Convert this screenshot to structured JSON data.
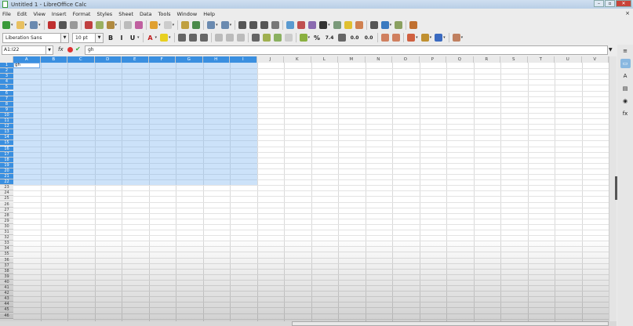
{
  "window": {
    "title": "Untitled 1 - LibreOffice Calc"
  },
  "menu": [
    "File",
    "Edit",
    "View",
    "Insert",
    "Format",
    "Styles",
    "Sheet",
    "Data",
    "Tools",
    "Window",
    "Help"
  ],
  "toolbar1": [
    {
      "n": "new-icon",
      "c": "#3a9a3a",
      "dd": true
    },
    {
      "n": "open-icon",
      "c": "#e8c060",
      "dd": true
    },
    {
      "n": "save-icon",
      "c": "#6a8ab0",
      "dd": true
    },
    {
      "sep": true
    },
    {
      "n": "export-pdf-icon",
      "c": "#c03030"
    },
    {
      "n": "print-icon",
      "c": "#555"
    },
    {
      "n": "print-preview-icon",
      "c": "#999"
    },
    {
      "sep": true
    },
    {
      "n": "cut-icon",
      "c": "#c04040"
    },
    {
      "n": "copy-icon",
      "c": "#9ab060"
    },
    {
      "n": "paste-icon",
      "c": "#b08a40",
      "dd": true
    },
    {
      "sep": true
    },
    {
      "n": "clone-formatting-icon",
      "c": "#bbb"
    },
    {
      "n": "clear-formatting-icon",
      "c": "#c060a0"
    },
    {
      "sep": true
    },
    {
      "n": "undo-icon",
      "c": "#e0a030",
      "dd": true
    },
    {
      "n": "redo-icon",
      "c": "#ccc",
      "dd": true
    },
    {
      "sep": true
    },
    {
      "n": "find-replace-icon",
      "c": "#c0a040"
    },
    {
      "n": "spelling-icon",
      "c": "#4a8a4a"
    },
    {
      "sep": true
    },
    {
      "n": "row-icon",
      "c": "#6a8ab0",
      "dd": true
    },
    {
      "n": "column-icon",
      "c": "#6a8ab0",
      "dd": true
    },
    {
      "sep": true
    },
    {
      "n": "sort-icon",
      "c": "#555"
    },
    {
      "n": "sort-ascending-icon",
      "c": "#555"
    },
    {
      "n": "sort-descending-icon",
      "c": "#555"
    },
    {
      "n": "autofilter-icon",
      "c": "#777"
    },
    {
      "sep": true
    },
    {
      "n": "image-icon",
      "c": "#5a9ad0"
    },
    {
      "n": "chart-icon",
      "c": "#c05050"
    },
    {
      "n": "pivot-table-icon",
      "c": "#8a6ab0"
    },
    {
      "n": "special-character-icon",
      "c": "#333",
      "dd": true
    },
    {
      "n": "hyperlink-icon",
      "c": "#7a9a7a"
    },
    {
      "n": "comment-icon",
      "c": "#e0c030"
    },
    {
      "n": "header-footer-icon",
      "c": "#d08050"
    },
    {
      "sep": true
    },
    {
      "n": "define-print-area-icon",
      "c": "#555"
    },
    {
      "n": "freeze-rows-columns-icon",
      "c": "#3a7ac0",
      "dd": true
    },
    {
      "n": "split-window-icon",
      "c": "#8aa060"
    },
    {
      "sep": true
    },
    {
      "n": "show-draw-functions-icon",
      "c": "#c07030"
    }
  ],
  "toolbar2": {
    "font_name": "Liberation Sans",
    "font_size": "10 pt",
    "icons": [
      {
        "n": "bold-icon",
        "t": "B"
      },
      {
        "n": "italic-icon",
        "t": "I"
      },
      {
        "n": "underline-icon",
        "t": "U",
        "dd": true
      },
      {
        "sep": true
      },
      {
        "n": "font-color-icon",
        "t": "A",
        "col": "#c02020",
        "dd": true
      },
      {
        "n": "highlight-color-icon",
        "c": "#e8d020",
        "dd": true
      },
      {
        "sep": true
      },
      {
        "n": "align-left-icon",
        "c": "#666"
      },
      {
        "n": "align-center-icon",
        "c": "#666"
      },
      {
        "n": "align-right-icon",
        "c": "#666"
      },
      {
        "sep": true
      },
      {
        "n": "align-top-icon",
        "c": "#bbb"
      },
      {
        "n": "align-center-vertical-icon",
        "c": "#bbb"
      },
      {
        "n": "align-bottom-icon",
        "c": "#bbb"
      },
      {
        "sep": true
      },
      {
        "n": "wrap-text-icon",
        "c": "#666"
      },
      {
        "n": "merge-center-icon",
        "c": "#a0b050"
      },
      {
        "n": "merge-cells-icon",
        "c": "#8ab060"
      },
      {
        "n": "unmerge-cells-icon",
        "c": "#ccc"
      },
      {
        "sep": true
      },
      {
        "n": "currency-icon",
        "c": "#8ab040",
        "dd": true
      },
      {
        "n": "percent-icon",
        "t": "%"
      },
      {
        "n": "number-format-icon",
        "t": "7.4"
      },
      {
        "n": "date-format-icon",
        "c": "#666"
      },
      {
        "n": "add-decimal-icon",
        "t": "0.0"
      },
      {
        "n": "delete-decimal-icon",
        "t": "0.0"
      },
      {
        "sep": true
      },
      {
        "n": "increase-indent-icon",
        "c": "#d08060"
      },
      {
        "n": "decrease-indent-icon",
        "c": "#d08060"
      },
      {
        "sep": true
      },
      {
        "n": "borders-icon",
        "c": "#d06040",
        "dd": true
      },
      {
        "n": "border-style-icon",
        "c": "#c09030",
        "dd": true
      },
      {
        "n": "background-color-icon",
        "c": "#3a6ac0",
        "dd": true
      },
      {
        "sep": true
      },
      {
        "n": "conditional-format-icon",
        "c": "#c08060",
        "dd": true
      }
    ]
  },
  "formula": {
    "name_box": "A1:I22",
    "fx": "fx",
    "value": "gh"
  },
  "sheet": {
    "columns": [
      "A",
      "B",
      "C",
      "D",
      "E",
      "F",
      "G",
      "H",
      "I",
      "J",
      "K",
      "L",
      "M",
      "N",
      "O",
      "P",
      "Q",
      "R",
      "S",
      "T",
      "U",
      "V"
    ],
    "row_count": 46,
    "cell_A1": "gh",
    "selection": "A1:I22",
    "selected_columns": 9,
    "selected_rows": 22
  },
  "sidebar": [
    {
      "n": "properties-icon",
      "t": "▭"
    },
    {
      "n": "styles-icon",
      "t": "A"
    },
    {
      "n": "gallery-icon",
      "t": "▤"
    },
    {
      "n": "navigator-icon",
      "t": "◉"
    },
    {
      "n": "functions-icon",
      "t": "fx"
    }
  ],
  "sidebar_menu": "≡"
}
